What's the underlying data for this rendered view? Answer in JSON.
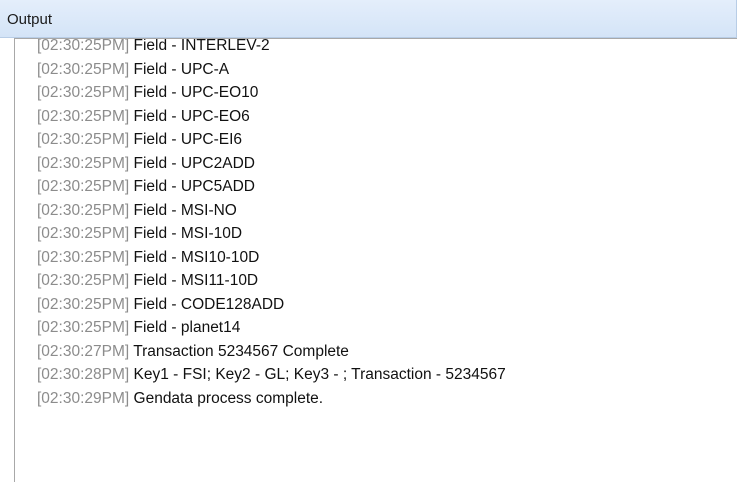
{
  "panel": {
    "title": "Output"
  },
  "log": [
    {
      "time": "[02:30:25PM]",
      "message": "Field - INTERLEV-2"
    },
    {
      "time": "[02:30:25PM]",
      "message": "Field - UPC-A"
    },
    {
      "time": "[02:30:25PM]",
      "message": "Field - UPC-EO10"
    },
    {
      "time": "[02:30:25PM]",
      "message": "Field - UPC-EO6"
    },
    {
      "time": "[02:30:25PM]",
      "message": "Field - UPC-EI6"
    },
    {
      "time": "[02:30:25PM]",
      "message": "Field - UPC2ADD"
    },
    {
      "time": "[02:30:25PM]",
      "message": "Field - UPC5ADD"
    },
    {
      "time": "[02:30:25PM]",
      "message": "Field - MSI-NO"
    },
    {
      "time": "[02:30:25PM]",
      "message": "Field - MSI-10D"
    },
    {
      "time": "[02:30:25PM]",
      "message": "Field - MSI10-10D"
    },
    {
      "time": "[02:30:25PM]",
      "message": "Field - MSI11-10D"
    },
    {
      "time": "[02:30:25PM]",
      "message": "Field - CODE128ADD"
    },
    {
      "time": "[02:30:25PM]",
      "message": "Field - planet14"
    },
    {
      "time": "[02:30:27PM]",
      "message": "Transaction 5234567 Complete"
    },
    {
      "time": "[02:30:28PM]",
      "message": "Key1 - FSI; Key2 - GL; Key3 - ; Transaction - 5234567"
    },
    {
      "time": "[02:30:29PM]",
      "message": "Gendata process complete."
    }
  ]
}
